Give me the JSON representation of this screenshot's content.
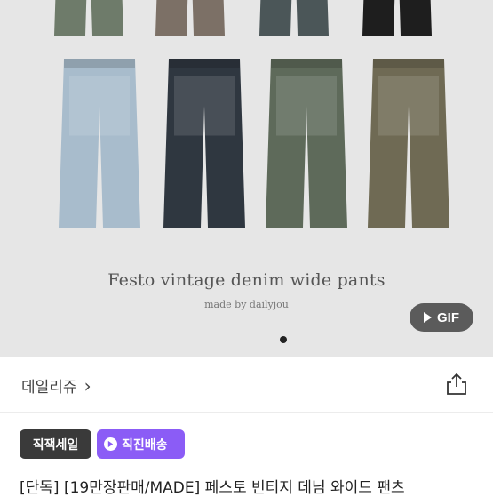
{
  "hero": {
    "title": "Festo vintage denim wide pants",
    "subtitle": "made by dailyjou",
    "gif_badge": "GIF",
    "colors": {
      "top_row": [
        "#6e7b6a",
        "#7c7066",
        "#4b5658",
        "#1e1e1e"
      ],
      "bottom_row": [
        "#a8bccc",
        "#2f3740",
        "#5e6a5a",
        "#6f6a54"
      ]
    }
  },
  "store": {
    "name": "데일리쥬",
    "chevron": "›"
  },
  "tags": [
    {
      "label": "직잭세일"
    },
    {
      "label": "직진배송"
    }
  ],
  "product": {
    "title": "[단독] [19만장판매/MADE] 페스토 빈티지 데님 와이드 팬츠"
  }
}
